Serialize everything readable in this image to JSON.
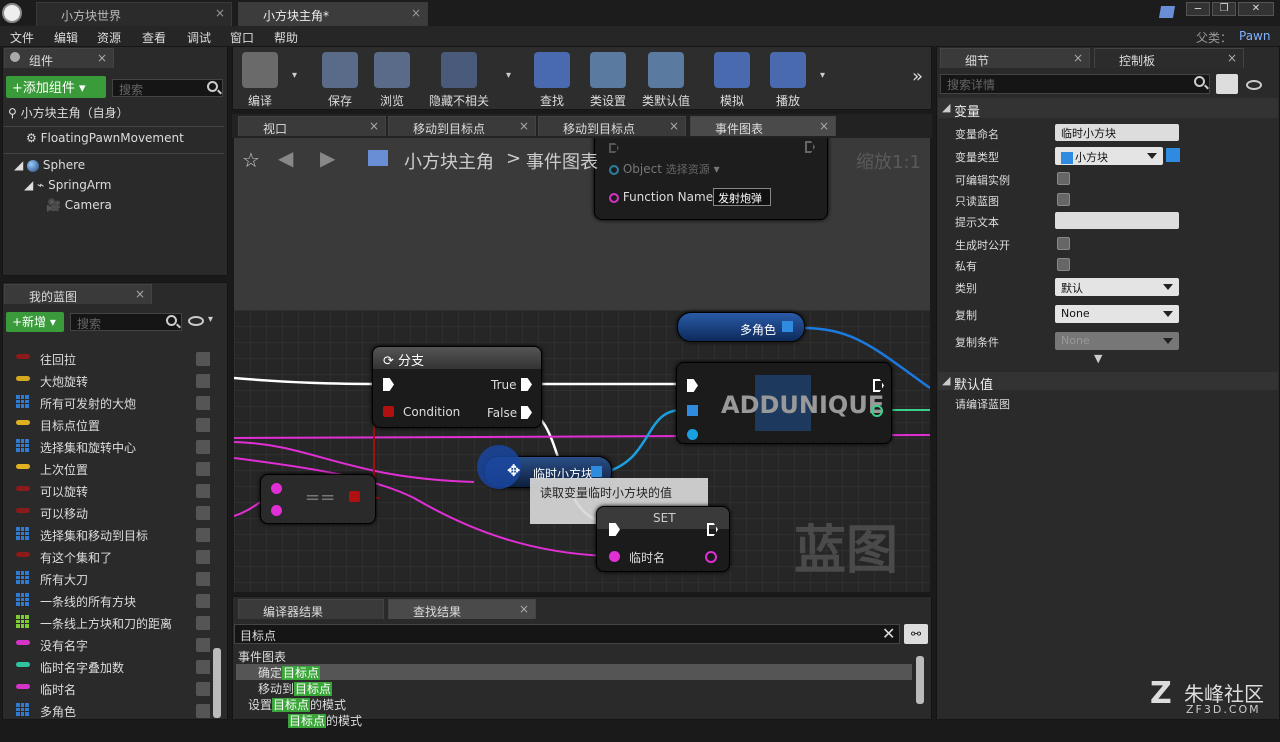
{
  "window": {
    "tabs": [
      {
        "label": "小方块世界"
      },
      {
        "label": "小方块主角*"
      }
    ],
    "parent_label": "父类：",
    "parent_value": "Pawn"
  },
  "menu": [
    "文件",
    "编辑",
    "资源",
    "查看",
    "调试",
    "窗口",
    "帮助"
  ],
  "components": {
    "tab_label": "组件",
    "add_button": "+添加组件",
    "search_placeholder": "搜索",
    "self_label": "小方块主角（自身）",
    "items": [
      "FloatingPawnMovement",
      "Sphere",
      "SpringArm",
      "Camera"
    ]
  },
  "blueprint": {
    "tab_label": "我的蓝图",
    "new_button": "+新增",
    "search_placeholder": "搜索",
    "variables": [
      {
        "label": "往回拉",
        "type": "bool",
        "color": "#8b1a1a"
      },
      {
        "label": "大炮旋转",
        "type": "rot",
        "color": "#d6a820"
      },
      {
        "label": "所有可发射的大炮",
        "type": "grid",
        "color": "#2f7bd4"
      },
      {
        "label": "目标点位置",
        "type": "vec",
        "color": "#e0b020"
      },
      {
        "label": "选择集和旋转中心",
        "type": "grid",
        "color": "#2f7bd4"
      },
      {
        "label": "上次位置",
        "type": "vec",
        "color": "#e0b020"
      },
      {
        "label": "可以旋转",
        "type": "bool",
        "color": "#8b1a1a"
      },
      {
        "label": "可以移动",
        "type": "bool",
        "color": "#8b1a1a"
      },
      {
        "label": "选择集和移动到目标",
        "type": "set",
        "color": "#2f7bd4"
      },
      {
        "label": "有这个集和了",
        "type": "bool",
        "color": "#8b1a1a"
      },
      {
        "label": "所有大刀",
        "type": "grid",
        "color": "#2f7bd4"
      },
      {
        "label": "一条线的所有方块",
        "type": "grid",
        "color": "#2f7bd4"
      },
      {
        "label": "一条线上方块和刀的距离",
        "type": "grid",
        "color": "#7fcc30"
      },
      {
        "label": "没有名字",
        "type": "name",
        "color": "#d633c7"
      },
      {
        "label": "临时名字叠加数",
        "type": "int",
        "color": "#2dc4a0"
      },
      {
        "label": "临时名",
        "type": "name",
        "color": "#d633c7"
      },
      {
        "label": "多角色",
        "type": "set",
        "color": "#2f7bd4"
      }
    ]
  },
  "toolbar": {
    "buttons": [
      {
        "label": "编译",
        "icon": "compile-icon"
      },
      {
        "label": "保存",
        "icon": "save-icon"
      },
      {
        "label": "浏览",
        "icon": "browse-icon"
      },
      {
        "label": "隐藏不相关",
        "icon": "hide-unrelated-icon"
      },
      {
        "label": "查找",
        "icon": "find-icon"
      },
      {
        "label": "类设置",
        "icon": "class-settings-icon"
      },
      {
        "label": "类默认值",
        "icon": "class-defaults-icon"
      },
      {
        "label": "模拟",
        "icon": "simulate-icon"
      },
      {
        "label": "播放",
        "icon": "play-icon"
      }
    ]
  },
  "editor_tabs": [
    "视口",
    "移动到目标点",
    "移动到目标点",
    "事件图表"
  ],
  "breadcrumb": {
    "root": "小方块主角",
    "separator": ">",
    "current": "事件图表",
    "zoom": "缩放1:1"
  },
  "graph": {
    "call_node": {
      "object_label": "Object",
      "object_value": "选择资源",
      "function_label": "Function Name",
      "function_value": "发射炮弹"
    },
    "branch": {
      "title": "分支",
      "condition": "Condition",
      "true_label": "True",
      "false_label": "False"
    },
    "equals": {
      "title": "=="
    },
    "multi_role": {
      "label": "多角色"
    },
    "add_unique": {
      "title": "ADDUNIQUE"
    },
    "temp_var": {
      "label": "临时小方块"
    },
    "tooltip": "读取变量临时小方块的值",
    "set_node": {
      "title": "SET",
      "pin": "临时名"
    },
    "watermark": "蓝图"
  },
  "details": {
    "tabs": [
      "细节",
      "控制板"
    ],
    "search_placeholder": "搜索详情",
    "section_variable": "变量",
    "rows": [
      {
        "label": "变量命名",
        "kind": "text",
        "value": "临时小方块"
      },
      {
        "label": "变量类型",
        "kind": "type",
        "value": "小方块"
      },
      {
        "label": "可编辑实例",
        "kind": "check"
      },
      {
        "label": "只读蓝图",
        "kind": "check"
      },
      {
        "label": "提示文本",
        "kind": "text",
        "value": ""
      },
      {
        "label": "生成时公开",
        "kind": "check"
      },
      {
        "label": "私有",
        "kind": "check"
      },
      {
        "label": "类别",
        "kind": "drop",
        "value": "默认"
      },
      {
        "label": "复制",
        "kind": "drop",
        "value": "None"
      },
      {
        "label": "复制条件",
        "kind": "drop_dis",
        "value": "None"
      }
    ],
    "section_default": "默认值",
    "default_note": "请编译蓝图"
  },
  "results": {
    "tabs": [
      "编译器结果",
      "查找结果"
    ],
    "query": "目标点",
    "rows": [
      {
        "pre": "事件图表",
        "hl": "",
        "post": ""
      },
      {
        "pre": "确定",
        "hl": "目标点",
        "post": ""
      },
      {
        "pre": "移动到",
        "hl": "目标点",
        "post": ""
      },
      {
        "pre": "设置",
        "hl": "目标点",
        "post": "的模式"
      },
      {
        "pre": "",
        "hl": "目标点",
        "post": "的模式"
      }
    ]
  },
  "watermark_brand": {
    "name": "朱峰社区",
    "url": "ZF3D.COM"
  }
}
